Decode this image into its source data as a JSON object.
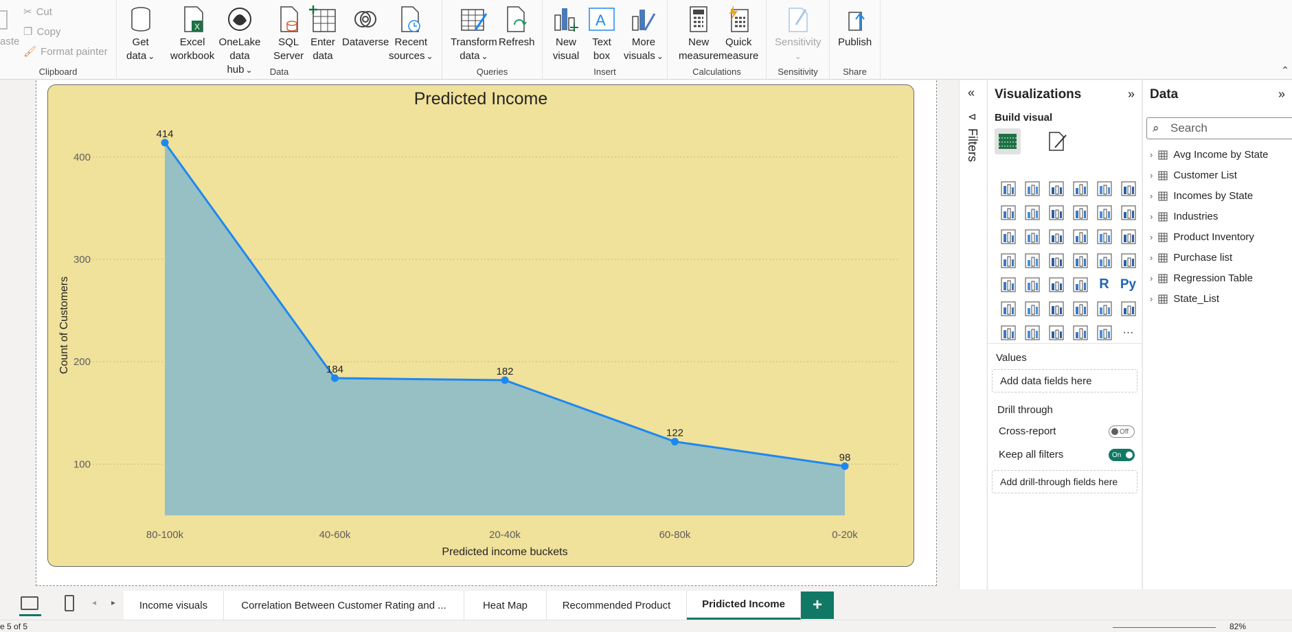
{
  "ribbon": {
    "clipboard": {
      "label": "Clipboard",
      "paste": "aste",
      "cut": "Cut",
      "copy": "Copy",
      "format_painter": "Format painter"
    },
    "data_group": {
      "label": "Data",
      "get_data": [
        "Get",
        "data"
      ],
      "excel": [
        "Excel",
        "workbook"
      ],
      "onelake": [
        "OneLake data",
        "hub"
      ],
      "sql": [
        "SQL",
        "Server"
      ],
      "enter": [
        "Enter",
        "data"
      ],
      "dataverse": "Dataverse",
      "recent": [
        "Recent",
        "sources"
      ]
    },
    "queries": {
      "label": "Queries",
      "transform": [
        "Transform",
        "data"
      ],
      "refresh": "Refresh"
    },
    "insert": {
      "label": "Insert",
      "new_visual": [
        "New",
        "visual"
      ],
      "text_box": [
        "Text",
        "box"
      ],
      "more_visuals": [
        "More",
        "visuals"
      ]
    },
    "calculations": {
      "label": "Calculations",
      "new_measure": [
        "New",
        "measure"
      ],
      "quick_measure": [
        "Quick",
        "measure"
      ]
    },
    "sensitivity": {
      "label": "Sensitivity",
      "button": "Sensitivity"
    },
    "share": {
      "label": "Share",
      "publish": "Publish"
    }
  },
  "chart_data": {
    "type": "area",
    "title": "Predicted Income",
    "xlabel": "Predicted income buckets",
    "ylabel": "Count of Customers",
    "categories": [
      "80-100k",
      "40-60k",
      "20-40k",
      "60-80k",
      "0-20k"
    ],
    "values": [
      414,
      184,
      182,
      122,
      98
    ],
    "data_labels": [
      "414",
      "184",
      "182",
      "122",
      "98"
    ],
    "yticks": [
      100,
      200,
      300,
      400
    ],
    "ylim": [
      50,
      430
    ],
    "grid": true,
    "colors": {
      "line": "#1e88f0",
      "fill": "#96c0c4",
      "background": "#f0e19b"
    }
  },
  "filters": {
    "label": "Filters"
  },
  "visualizations": {
    "title": "Visualizations",
    "build_visual": "Build visual",
    "values_label": "Values",
    "values_placeholder": "Add data fields here",
    "drill_through": "Drill through",
    "cross_report": "Cross-report",
    "cross_report_state": "Off",
    "keep_filters": "Keep all filters",
    "keep_filters_state": "On",
    "drill_placeholder": "Add drill-through fields here",
    "more": "···"
  },
  "data_pane": {
    "title": "Data",
    "search_placeholder": "Search",
    "tables": [
      "Avg Income by State",
      "Customer List",
      "Incomes by State",
      "Industries",
      "Product Inventory",
      "Purchase list",
      "Regression Table",
      "State_List"
    ]
  },
  "tabs": [
    "Income visuals",
    "Correlation Between Customer Rating and ...",
    "Heat Map",
    "Recommended Product",
    "Pridicted Income"
  ],
  "add_tab": "+",
  "status": {
    "page": "e 5 of 5",
    "zoom": "82%"
  }
}
